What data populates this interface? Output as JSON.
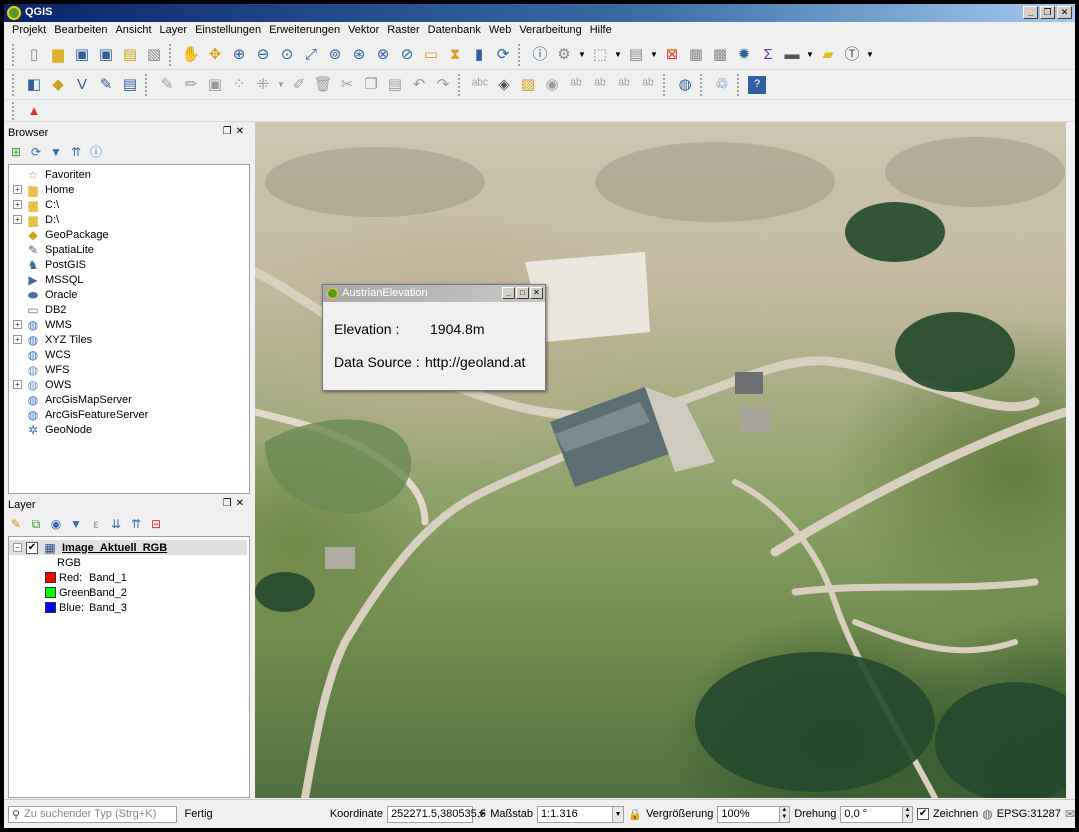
{
  "window": {
    "title": "QGIS",
    "controls": [
      "_",
      "❐",
      "✕"
    ]
  },
  "menu": [
    "Projekt",
    "Bearbeiten",
    "Ansicht",
    "Layer",
    "Einstellungen",
    "Erweiterungen",
    "Vektor",
    "Raster",
    "Datenbank",
    "Web",
    "Verarbeitung",
    "Hilfe"
  ],
  "browser": {
    "title": "Browser",
    "items": [
      {
        "label": "Favoriten",
        "icon": "star-icon",
        "glyph": "☆",
        "color": "#b0a040",
        "expandable": false
      },
      {
        "label": "Home",
        "icon": "folder-icon",
        "glyph": "▆",
        "color": "#e8c04a",
        "expandable": true
      },
      {
        "label": "C:\\",
        "icon": "folder-icon",
        "glyph": "▆",
        "color": "#e8c04a",
        "expandable": true
      },
      {
        "label": "D:\\",
        "icon": "folder-icon",
        "glyph": "▆",
        "color": "#e8c04a",
        "expandable": true
      },
      {
        "label": "GeoPackage",
        "icon": "geopackage-icon",
        "glyph": "◆",
        "color": "#d8a020",
        "expandable": false
      },
      {
        "label": "SpatiaLite",
        "icon": "spatialite-icon",
        "glyph": "✎",
        "color": "#406090",
        "expandable": false
      },
      {
        "label": "PostGIS",
        "icon": "postgis-icon",
        "glyph": "♞",
        "color": "#336699",
        "expandable": false
      },
      {
        "label": "MSSQL",
        "icon": "mssql-icon",
        "glyph": "▶",
        "color": "#4a6a9a",
        "expandable": false
      },
      {
        "label": "Oracle",
        "icon": "oracle-icon",
        "glyph": "⬬",
        "color": "#4a70a0",
        "expandable": false
      },
      {
        "label": "DB2",
        "icon": "db2-icon",
        "glyph": "▭",
        "color": "#5a7aa8",
        "expandable": false
      },
      {
        "label": "WMS",
        "icon": "wms-globe-icon",
        "glyph": "◍",
        "color": "#3a70b0",
        "expandable": true
      },
      {
        "label": "XYZ Tiles",
        "icon": "xyz-globe-icon",
        "glyph": "◍",
        "color": "#3a70b0",
        "expandable": true
      },
      {
        "label": "WCS",
        "icon": "wcs-globe-icon",
        "glyph": "◍",
        "color": "#3a70b0",
        "expandable": false
      },
      {
        "label": "WFS",
        "icon": "wfs-globe-icon",
        "glyph": "◍",
        "color": "#6a90c0",
        "expandable": false
      },
      {
        "label": "OWS",
        "icon": "ows-globe-icon",
        "glyph": "◍",
        "color": "#6a90c0",
        "expandable": true
      },
      {
        "label": "ArcGisMapServer",
        "icon": "arcgis-map-icon",
        "glyph": "◍",
        "color": "#3a70b0",
        "expandable": false
      },
      {
        "label": "ArcGisFeatureServer",
        "icon": "arcgis-feature-icon",
        "glyph": "◍",
        "color": "#3a70b0",
        "expandable": false
      },
      {
        "label": "GeoNode",
        "icon": "geonode-icon",
        "glyph": "✲",
        "color": "#3a70b0",
        "expandable": false
      }
    ]
  },
  "layers": {
    "title": "Layer",
    "layer_name": "Image_Aktuell_RGB",
    "renderer": "RGB",
    "bands": [
      {
        "channel": "Red:",
        "band": "Band_1",
        "color": "#ff0000"
      },
      {
        "channel": "Green:",
        "band": "Band_2",
        "color": "#00ff00"
      },
      {
        "channel": "Blue:",
        "band": "Band_3",
        "color": "#0000ff"
      }
    ]
  },
  "popup": {
    "title": "AustrianElevation",
    "elevation_label": "Elevation :",
    "elevation_value": "1904.8m",
    "source_label": "Data Source :",
    "source_value": "http://geoland.at"
  },
  "status": {
    "search_placeholder": "Zu suchender Typ (Strg+K)",
    "state": "Fertig",
    "coord_label": "Koordinate",
    "coord_value": "252271.5,380535.6",
    "scale_label": "Maßstab",
    "scale_value": "1:1.316",
    "zoom_label": "Vergrößerung",
    "zoom_value": "100%",
    "rotation_label": "Drehung",
    "rotation_value": "0,0 °",
    "render_label": "Zeichnen",
    "crs": "EPSG:31287"
  }
}
